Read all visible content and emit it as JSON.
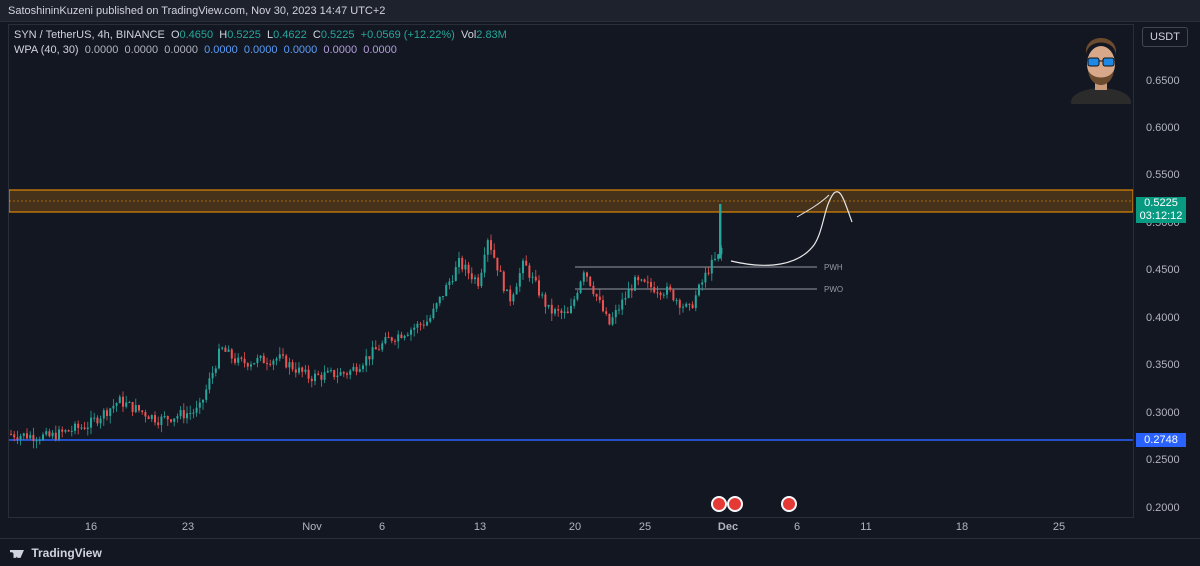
{
  "publish_bar": {
    "text": "SatoshininKuzeni published on TradingView.com, Nov 30, 2023 14:47 UTC+2"
  },
  "legend": {
    "symbol": "SYN / TetherUS, 4h, BINANCE",
    "o_label": "O",
    "o_value": "0.4650",
    "h_label": "H",
    "h_value": "0.5225",
    "l_label": "L",
    "l_value": "0.4622",
    "c_label": "C",
    "c_value": "0.5225",
    "change": "+0.0569 (+12.22%)",
    "vol_label": "Vol",
    "vol_value": "2.83M",
    "wpa_label": "WPA (40, 30)",
    "wpa_values": [
      "0.0000",
      "0.0000",
      "0.0000",
      "0.0000",
      "0.0000",
      "0.0000",
      "0.0000",
      "0.0000"
    ]
  },
  "currency_button": "USDT",
  "price_axis": {
    "ticks": [
      "0.6500",
      "0.6000",
      "0.5500",
      "0.5000",
      "0.4500",
      "0.4000",
      "0.3500",
      "0.3000",
      "0.2500",
      "0.2000"
    ],
    "last_price": "0.5225",
    "countdown": "03:12:12",
    "support_level": "0.2748"
  },
  "time_axis": {
    "labels": [
      "16",
      "23",
      "Nov",
      "6",
      "13",
      "20",
      "25",
      "Dec",
      "6",
      "11",
      "18",
      "25"
    ]
  },
  "annotations": {
    "pwh_label": "PWH",
    "pwo_label": "PWO"
  },
  "colors": {
    "background": "#131722",
    "up_candle": "#26a69a",
    "down_candle": "#ef5350",
    "resistance_zone": "#ff9800",
    "support_line": "#2962ff",
    "last_price_tag": "#089981"
  },
  "footer": {
    "brand": "TradingView"
  }
}
